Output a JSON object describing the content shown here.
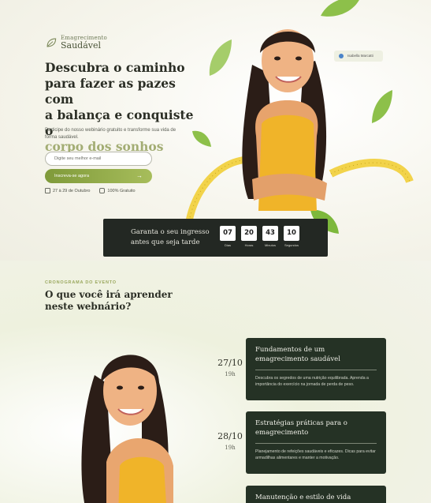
{
  "logo": {
    "small": "Emagrecimento",
    "main": "Saudável"
  },
  "hero": {
    "title_line1": "Descubra o caminho",
    "title_line2": "para fazer as pazes com",
    "title_line3": "a balança e conquiste o",
    "title_accent": "corpo dos sonhos",
    "subtitle": "Participe do nosso webinário gratuito e transforme sua vida de forma saudável.",
    "email_placeholder": "Digite seu melhor e-mail",
    "cta_label": "Inscreva-se agora",
    "cta_arrow": "→",
    "date_text": "27 à 29 de Outubro",
    "free_text": "100% Gratuito",
    "host_badge": "Isabella Marcatti"
  },
  "countdown": {
    "text_line1": "Garanta o seu ingresso",
    "text_line2": "antes que seja tarde",
    "cells": [
      {
        "value": "07",
        "label": "Dias"
      },
      {
        "value": "20",
        "label": "Horas"
      },
      {
        "value": "43",
        "label": "Minutos"
      },
      {
        "value": "10",
        "label": "Segundos"
      }
    ]
  },
  "schedule": {
    "eyebrow": "CRONOGRAMA DO EVENTO",
    "title_line1": "O que você irá aprender",
    "title_line2": "neste webnário?",
    "items": [
      {
        "date": "27/10",
        "time": "19h",
        "title": "Fundamentos de um emagrecimento saudável",
        "desc": "Descubra os segredos de uma nutrição equilibrada. Aprenda a importância do exercício na jornada de perda de peso."
      },
      {
        "date": "28/10",
        "time": "19h",
        "title": "Estratégias práticas para o emagrecimento",
        "desc": "Planejamento de refeições saudáveis e eficazes. Dicas para evitar armadilhas alimentares e manter a motivação."
      },
      {
        "date": "",
        "time": "",
        "title": "Manutenção e estilo de vida",
        "desc": ""
      }
    ]
  },
  "colors": {
    "accent": "#a3ad74",
    "dark": "#253225",
    "cta": "#8aa745"
  }
}
